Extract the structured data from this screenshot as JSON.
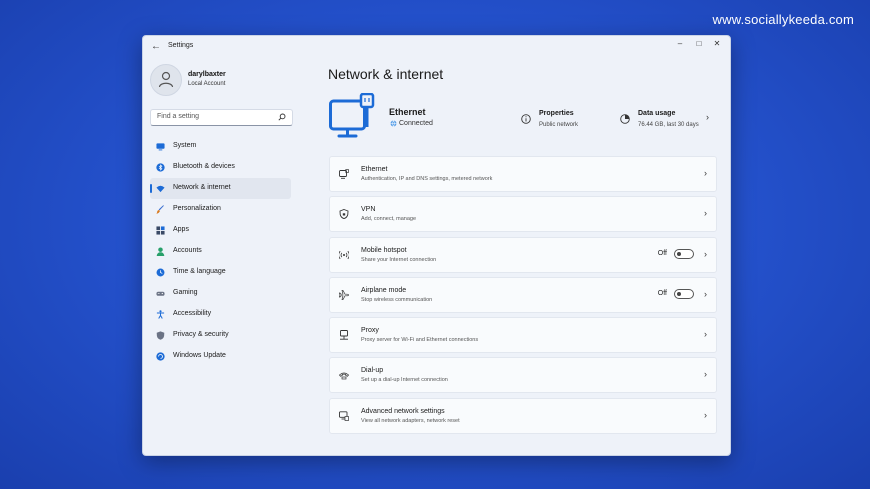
{
  "watermark": "www.sociallykeeda.com",
  "window": {
    "title": "Settings",
    "controls": {
      "minimize": "–",
      "maximize": "□",
      "close": "✕"
    }
  },
  "profile": {
    "name": "darylbaxter",
    "account_type": "Local Account"
  },
  "search": {
    "placeholder": "Find a setting"
  },
  "nav": [
    {
      "label": "System",
      "icon": "monitor-icon",
      "color": "#1c6bd6"
    },
    {
      "label": "Bluetooth & devices",
      "icon": "bluetooth-icon",
      "color": "#1c6bd6"
    },
    {
      "label": "Network & internet",
      "icon": "wifi-icon",
      "color": "#1c6bd6",
      "active": true
    },
    {
      "label": "Personalization",
      "icon": "brush-icon",
      "color": "#d97a1f"
    },
    {
      "label": "Apps",
      "icon": "apps-icon",
      "color": "#3a4a66"
    },
    {
      "label": "Accounts",
      "icon": "person-icon",
      "color": "#27a06a"
    },
    {
      "label": "Time & language",
      "icon": "globe-clock-icon",
      "color": "#1c6bd6"
    },
    {
      "label": "Gaming",
      "icon": "gamepad-icon",
      "color": "#6b7385"
    },
    {
      "label": "Accessibility",
      "icon": "accessibility-icon",
      "color": "#1c6bd6"
    },
    {
      "label": "Privacy & security",
      "icon": "shield-icon",
      "color": "#6b7385"
    },
    {
      "label": "Windows Update",
      "icon": "update-icon",
      "color": "#1c6bd6"
    }
  ],
  "main": {
    "title": "Network & internet",
    "hero": {
      "name": "Ethernet",
      "status": "Connected"
    },
    "properties": {
      "title": "Properties",
      "subtitle": "Public network"
    },
    "data_usage": {
      "title": "Data usage",
      "subtitle": "76.44 GB, last 30 days"
    },
    "rows": [
      {
        "title": "Ethernet",
        "subtitle": "Authentication, IP and DNS settings, metered network",
        "icon": "ethernet-icon"
      },
      {
        "title": "VPN",
        "subtitle": "Add, connect, manage",
        "icon": "vpn-shield-icon"
      },
      {
        "title": "Mobile hotspot",
        "subtitle": "Share your Internet connection",
        "icon": "hotspot-icon",
        "toggle": "Off"
      },
      {
        "title": "Airplane mode",
        "subtitle": "Stop wireless communication",
        "icon": "airplane-icon",
        "toggle": "Off"
      },
      {
        "title": "Proxy",
        "subtitle": "Proxy server for Wi-Fi and Ethernet connections",
        "icon": "proxy-icon"
      },
      {
        "title": "Dial-up",
        "subtitle": "Set up a dial-up Internet connection",
        "icon": "dialup-icon"
      },
      {
        "title": "Advanced network settings",
        "subtitle": "View all network adapters, network reset",
        "icon": "network-adapter-icon"
      }
    ]
  },
  "colors": {
    "accent": "#1c6bd6",
    "desktop": "#2553cf",
    "window_bg": "#eef2f9"
  }
}
